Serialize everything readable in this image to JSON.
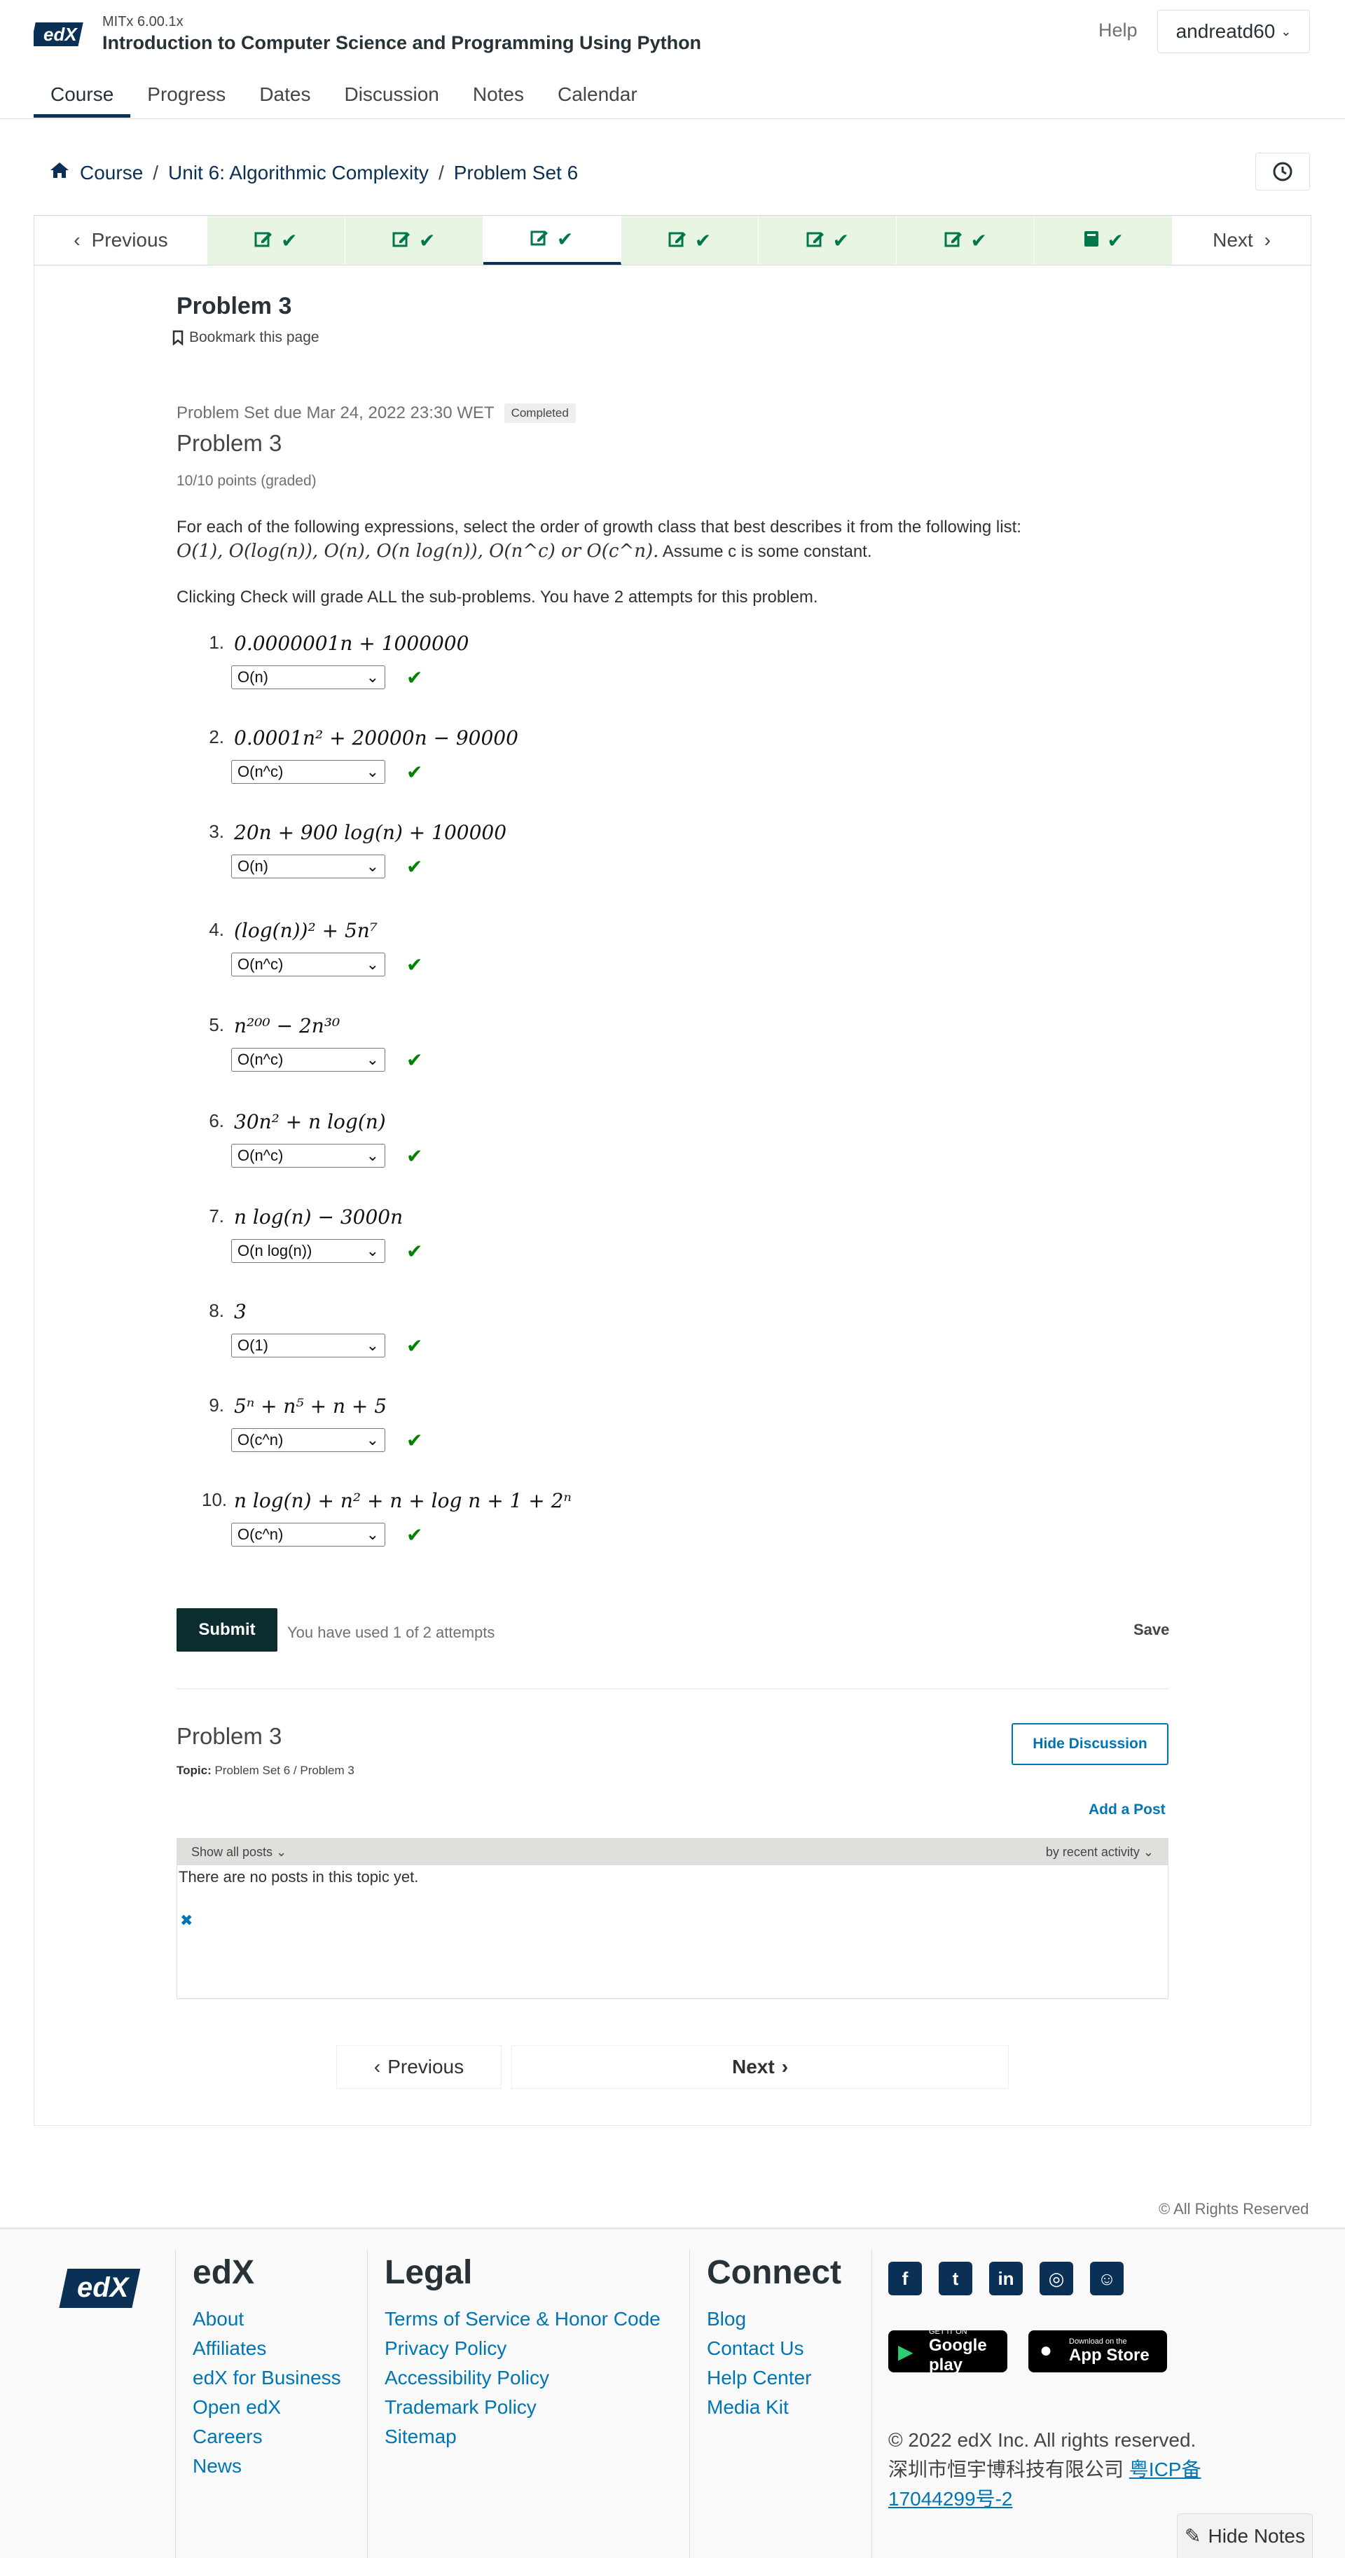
{
  "header": {
    "course_code": "MITx 6.00.1x",
    "course_title": "Introduction to Computer Science and Programming Using Python",
    "help": "Help",
    "username": "andreatd60"
  },
  "tabs": [
    {
      "label": "Course",
      "active": true
    },
    {
      "label": "Progress"
    },
    {
      "label": "Dates"
    },
    {
      "label": "Discussion"
    },
    {
      "label": "Notes"
    },
    {
      "label": "Calendar"
    }
  ],
  "breadcrumb": {
    "home": "Course",
    "unit": "Unit 6: Algorithmic Complexity",
    "section": "Problem Set 6"
  },
  "sequence": {
    "previous": "Previous",
    "next": "Next",
    "items": [
      {
        "icon": "edit-icon",
        "done": true
      },
      {
        "icon": "edit-icon",
        "done": true
      },
      {
        "icon": "edit-icon",
        "done": true,
        "active": true
      },
      {
        "icon": "edit-icon",
        "done": true
      },
      {
        "icon": "edit-icon",
        "done": true
      },
      {
        "icon": "edit-icon",
        "done": true
      },
      {
        "icon": "book-icon",
        "done": true
      }
    ]
  },
  "unit": {
    "title": "Problem 3",
    "bookmark": "Bookmark this page"
  },
  "problem": {
    "due": "Problem Set due Mar 24, 2022 23:30 WET",
    "status": "Completed",
    "heading": "Problem 3",
    "points": "10/10 points (graded)",
    "intro": "For each of the following expressions, select the order of growth class that best describes it from the following list:",
    "classes": "O(1), O(log(n)), O(n), O(n log(n)), O(n^c) or O(c^n).",
    "constant_note": "Assume c is some constant.",
    "check_note": "Clicking Check will grade ALL the sub-problems. You have 2 attempts for this problem.",
    "questions": [
      {
        "num": "1.",
        "expr": "0.0000001n + 1000000",
        "answer": "O(n)"
      },
      {
        "num": "2.",
        "expr": "0.0001n² + 20000n − 90000",
        "answer": "O(n^c)"
      },
      {
        "num": "3.",
        "expr": "20n + 900 log(n) + 100000",
        "answer": "O(n)"
      },
      {
        "num": "4.",
        "expr": "(log(n))² + 5n⁷",
        "answer": "O(n^c)"
      },
      {
        "num": "5.",
        "expr": "n²⁰⁰ − 2n³⁰",
        "answer": "O(n^c)"
      },
      {
        "num": "6.",
        "expr": "30n² + n log(n)",
        "answer": "O(n^c)"
      },
      {
        "num": "7.",
        "expr": "n log(n) − 3000n",
        "answer": "O(n log(n))"
      },
      {
        "num": "8.",
        "expr": "3",
        "answer": "O(1)"
      },
      {
        "num": "9.",
        "expr": "5ⁿ + n⁵ + n + 5",
        "answer": "O(c^n)"
      },
      {
        "num": "10.",
        "expr": "n log(n) + n² + n + log n + 1 + 2ⁿ",
        "answer": "O(c^n)"
      }
    ],
    "submit": "Submit",
    "attempts": "You have used 1 of 2 attempts",
    "save": "Save"
  },
  "discussion": {
    "heading": "Problem 3",
    "topic_label": "Topic:",
    "topic": "Problem Set 6 / Problem 3",
    "hide": "Hide Discussion",
    "add_post": "Add a Post",
    "filter": "Show all posts",
    "sort": "by recent activity",
    "empty": "There are no posts in this topic yet."
  },
  "pager": {
    "previous": "Previous",
    "next": "Next"
  },
  "rights": "All Rights Reserved",
  "footer": {
    "edx": {
      "title": "edX",
      "links": [
        "About",
        "Affiliates",
        "edX for Business",
        "Open edX",
        "Careers",
        "News"
      ]
    },
    "legal": {
      "title": "Legal",
      "links": [
        "Terms of Service & Honor Code",
        "Privacy Policy",
        "Accessibility Policy",
        "Trademark Policy",
        "Sitemap"
      ]
    },
    "connect": {
      "title": "Connect",
      "links": [
        "Blog",
        "Contact Us",
        "Help Center",
        "Media Kit"
      ]
    },
    "google_play": {
      "small": "GET IT ON",
      "big": "Google play"
    },
    "app_store": {
      "small": "Download on the",
      "big": "App Store"
    },
    "copyright": "© 2022 edX Inc. All rights reserved.",
    "icp_text": "深圳市恒宇博科技有限公司",
    "icp_link": "粤ICP备17044299号-2"
  },
  "hide_notes": "Hide Notes",
  "colors": {
    "brand": "#0a3055",
    "link": "#0075b4",
    "success": "#008100",
    "seq_done_bg": "#e8f5e2"
  }
}
